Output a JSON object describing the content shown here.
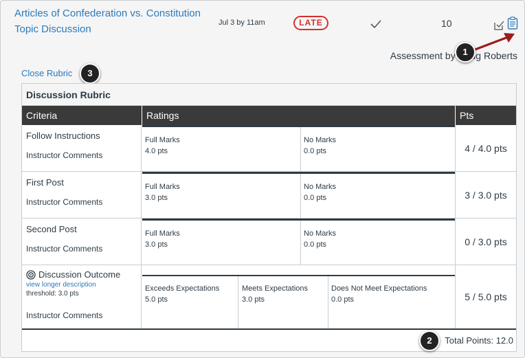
{
  "assignment": {
    "title": "Articles of Confederation vs. Constitution Topic Discussion",
    "due": "Jul 3 by 11am",
    "status_badge": "LATE",
    "score": "10"
  },
  "assessed_by": "Assessment by Doug Roberts",
  "close_rubric_label": "Close Rubric",
  "rubric": {
    "title": "Discussion Rubric",
    "headers": {
      "criteria": "Criteria",
      "ratings": "Ratings",
      "pts": "Pts"
    },
    "rows": [
      {
        "name": "Follow Instructions",
        "comments": "Instructor Comments",
        "ratings": [
          {
            "label": "Full Marks",
            "pts": "4.0 pts"
          },
          {
            "label": "No Marks",
            "pts": "0.0 pts"
          }
        ],
        "points": "4 / 4.0 pts"
      },
      {
        "name": "First Post",
        "comments": "Instructor Comments",
        "ratings": [
          {
            "label": "Full Marks",
            "pts": "3.0 pts"
          },
          {
            "label": "No Marks",
            "pts": "0.0 pts"
          }
        ],
        "points": "3 / 3.0 pts"
      },
      {
        "name": "Second Post",
        "comments": "Instructor Comments",
        "ratings": [
          {
            "label": "Full Marks",
            "pts": "3.0 pts"
          },
          {
            "label": "No Marks",
            "pts": "0.0 pts"
          }
        ],
        "points": "0 / 3.0 pts"
      },
      {
        "name": "Discussion Outcome",
        "long_description_link": "view longer description",
        "threshold": "threshold: 3.0 pts",
        "comments": "Instructor Comments",
        "ratings": [
          {
            "label": "Exceeds Expectations",
            "pts": "5.0 pts"
          },
          {
            "label": "Meets Expectations",
            "pts": "3.0 pts"
          },
          {
            "label": "Does Not Meet Expectations",
            "pts": "0.0 pts"
          }
        ],
        "points": "5 / 5.0 pts"
      }
    ],
    "total": "Total Points: 12.0"
  },
  "callouts": [
    "1",
    "2",
    "3"
  ],
  "colors": {
    "link": "#2b7abc",
    "late": "#d52e2e",
    "header_bg": "#3a3a3a",
    "arrow": "#9b1c1c"
  },
  "icons": [
    "checkmark-icon",
    "rubric-toggle-icon",
    "clipboard-icon",
    "outcome-target-icon"
  ]
}
